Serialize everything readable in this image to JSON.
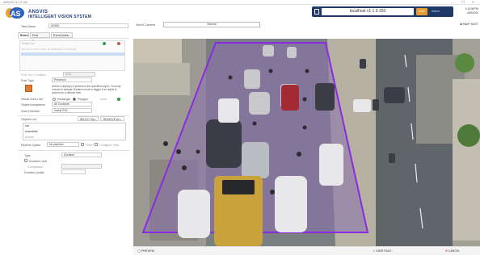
{
  "window": {
    "title": "ANSVIS v1.0.2.150",
    "controls": "— ❐ ✕"
  },
  "brand": {
    "line1": "ANSVIS",
    "line2": "INTELLIGENT VISION SYSTEM",
    "logo_text": "AS"
  },
  "status": {
    "address": "localhost v1.1.0.150",
    "badge": "IDLE",
    "user": "Admin"
  },
  "datetime": {
    "time": "4:19:08 PM",
    "date": "4/29/2024"
  },
  "form": {
    "task_name_label": "Task Name",
    "task_name_value": "ANSIS",
    "tabs": [
      "Rules",
      "Post Process",
      "Event Action"
    ],
    "rules_list_label": "Rules List",
    "rules_columns": "RULE   FUNCTION   ENABLED   LICENSE",
    "rule_join_label": "Rule Join Condition",
    "rule_join_value": "AND",
    "rule_type_label": "Rule Type",
    "rule_type_value": "Presence",
    "rule_desc": "Detect if object(s) is present in the specified region. You may choose to activate Duration mode to trigger if an object is present for a defined time.",
    "virtual_zone_label": "Virtual Zone Line",
    "rectangle_label": "Rectangle",
    "polygon_label": "Polygon",
    "zone_label": "Zone",
    "object_acceptance_label": "Object Acceptance",
    "object_acceptance_value": "All Contacts",
    "zone_direction_label": "Zone Direction",
    "zone_direction_value": "Inside ROI",
    "objects_list_label": "Objects List",
    "select_all": "SELECT ALL",
    "remove_all": "REMOVE ALL",
    "objects": [
      "car",
      "motorbike",
      "person"
    ],
    "pipeline_option_label": "Pipeline Option",
    "pipeline_value": "No pipeline",
    "filter_label": "Filter?",
    "configure_filter": "Configure Filter",
    "type_label": "Type",
    "type_value": "Duration",
    "duration_limit_label": "Duration Limit",
    "comparison_label": "Comparison",
    "duration_units_label": "Duration (units)"
  },
  "camera": {
    "select_label": "Select Camera",
    "selected": "Vehicle",
    "snapshot": "SNAP SHOT"
  },
  "footer": {
    "preview": "PREVIEW",
    "save_rule": "SAVE RULE",
    "cancel": "CANCEL"
  },
  "colors": {
    "accent": "#1f3a68",
    "zone": "#8a2be2",
    "road_tint": "#8a6fae",
    "save_green": "#2e9e44",
    "cancel_red": "#d9534f",
    "badge": "#e89a2c"
  }
}
